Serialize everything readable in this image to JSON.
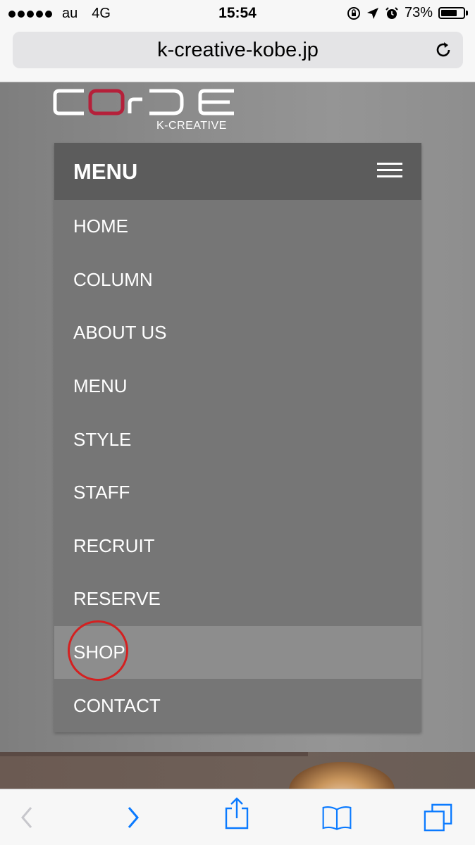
{
  "status_bar": {
    "carrier": "au",
    "network": "4G",
    "time": "15:54",
    "battery_percent": "73%",
    "battery_level": 0.73,
    "icons": [
      "orientation-lock-icon",
      "location-arrow-icon",
      "alarm-icon"
    ]
  },
  "browser": {
    "url": "k-creative-kobe.jp",
    "toolbar_icons": [
      "back-icon",
      "forward-icon",
      "share-icon",
      "bookmarks-icon",
      "tabs-icon"
    ]
  },
  "logo": {
    "wordmark": "COrDE",
    "subtitle": "K-CREATIVE"
  },
  "menu": {
    "title": "MENU",
    "items": [
      "HOME",
      "COLUMN",
      "ABOUT US",
      "MENU",
      "STYLE",
      "STAFF",
      "RECRUIT",
      "RESERVE",
      "SHOP",
      "CONTACT"
    ],
    "active_item": "SHOP"
  },
  "colors": {
    "panel": "#767676",
    "header": "#5c5c5c",
    "active": "#8d8d8d",
    "highlight": "#d42020",
    "ios_blue": "#0a7aff",
    "logo_red": "#b5203a"
  }
}
